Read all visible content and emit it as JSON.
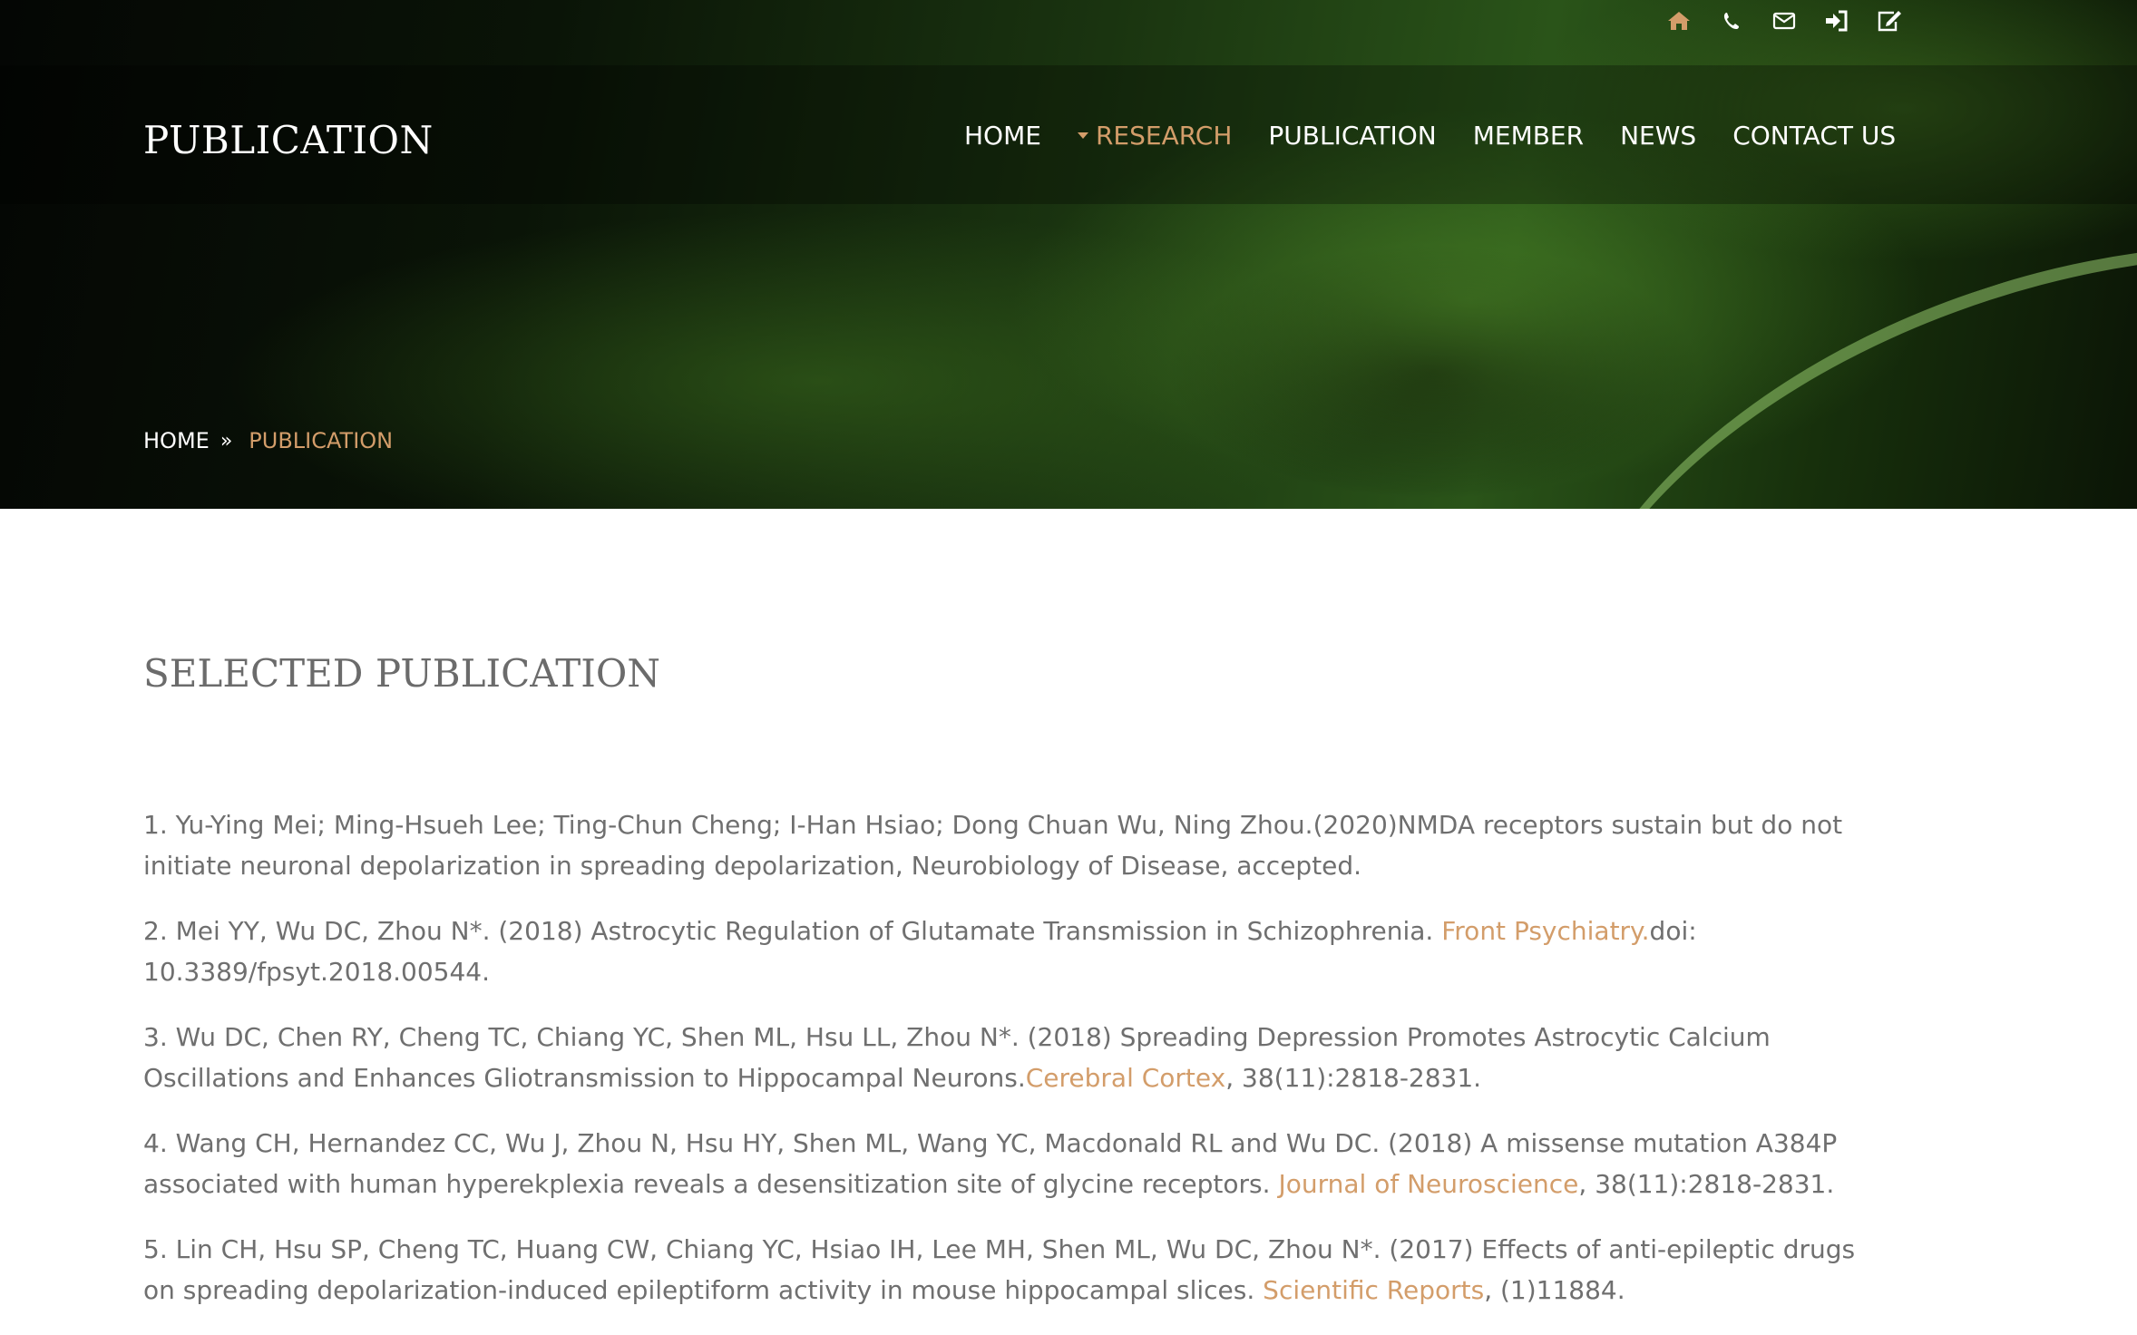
{
  "header": {
    "title": "PUBLICATION",
    "top_icons": [
      "home-icon",
      "phone-icon",
      "mail-icon",
      "login-icon",
      "edit-icon"
    ],
    "nav": [
      {
        "label": "HOME"
      },
      {
        "label": "RESEARCH",
        "active": true
      },
      {
        "label": "PUBLICATION"
      },
      {
        "label": "MEMBER"
      },
      {
        "label": "NEWS"
      },
      {
        "label": "CONTACT US"
      }
    ],
    "accent_color": "#d39d6a"
  },
  "breadcrumb": {
    "home": "HOME",
    "separator": "»",
    "current": "PUBLICATION"
  },
  "main": {
    "section_title": "SELECTED PUBLICATION",
    "publications": [
      {
        "line1": "1. Yu-Ying Mei; Ming-Hsueh Lee; Ting-Chun Cheng; I-Han Hsiao; Dong Chuan Wu,  Ning Zhou.(2020)NMDA receptors sustain but do not",
        "line2": "initiate neuronal depolarization in spreading depolarization, Neurobiology of Disease, accepted."
      },
      {
        "line1": "2. Mei YY, Wu DC, Zhou N*. (2018) Astrocytic Regulation of Glutamate Transmission in Schizophrenia. ",
        "journal": "Front Psychiatry.",
        "line1_end": "doi:",
        "line2": "10.3389/fpsyt.2018.00544."
      },
      {
        "line1": "3. Wu DC, Chen RY, Cheng TC, Chiang YC, Shen ML, Hsu LL, Zhou N*. (2018) Spreading Depression Promotes Astrocytic Calcium",
        "line2": "Oscillations and Enhances Gliotransmission to Hippocampal Neurons.",
        "journal": "Cerebral Cortex",
        "line2_end": ", 38(11):2818-2831."
      },
      {
        "line1": "4. Wang CH, Hernandez CC, Wu J, Zhou N, Hsu HY, Shen ML, Wang YC, Macdonald RL and Wu DC. (2018) A missense mutation A384P",
        "line2": "associated with human hyperekplexia reveals a desensitization site of glycine receptors. ",
        "journal": "Journal of Neuroscience",
        "line2_end": ", 38(11):2818-2831."
      },
      {
        "line1": "5. Lin CH, Hsu SP, Cheng TC, Huang CW, Chiang YC, Hsiao IH, Lee MH, Shen ML, Wu DC, Zhou N*. (2017) Effects of anti-epileptic drugs",
        "line2": "on spreading depolarization-induced epileptiform activity in mouse hippocampal slices. ",
        "journal": "Scientific Reports",
        "line2_end": ", (1)11884."
      }
    ]
  }
}
